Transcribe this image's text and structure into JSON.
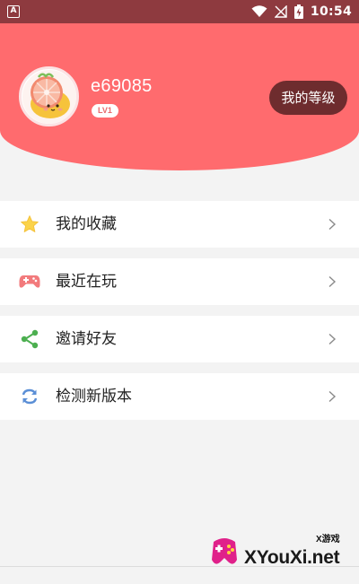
{
  "status_bar": {
    "notification_icon": "a-icon",
    "time": "10:54"
  },
  "profile": {
    "username": "e69085",
    "level": "LV1",
    "level_button": "我的等级",
    "header_color": "#ff6b6e"
  },
  "menu": {
    "items": [
      {
        "label": "我的收藏",
        "icon": "star-icon"
      },
      {
        "label": "最近在玩",
        "icon": "gamepad-icon"
      },
      {
        "label": "邀请好友",
        "icon": "share-icon"
      },
      {
        "label": "检测新版本",
        "icon": "refresh-icon"
      }
    ]
  },
  "watermark": {
    "small": "X游戏",
    "text": "XYouXi.net"
  }
}
